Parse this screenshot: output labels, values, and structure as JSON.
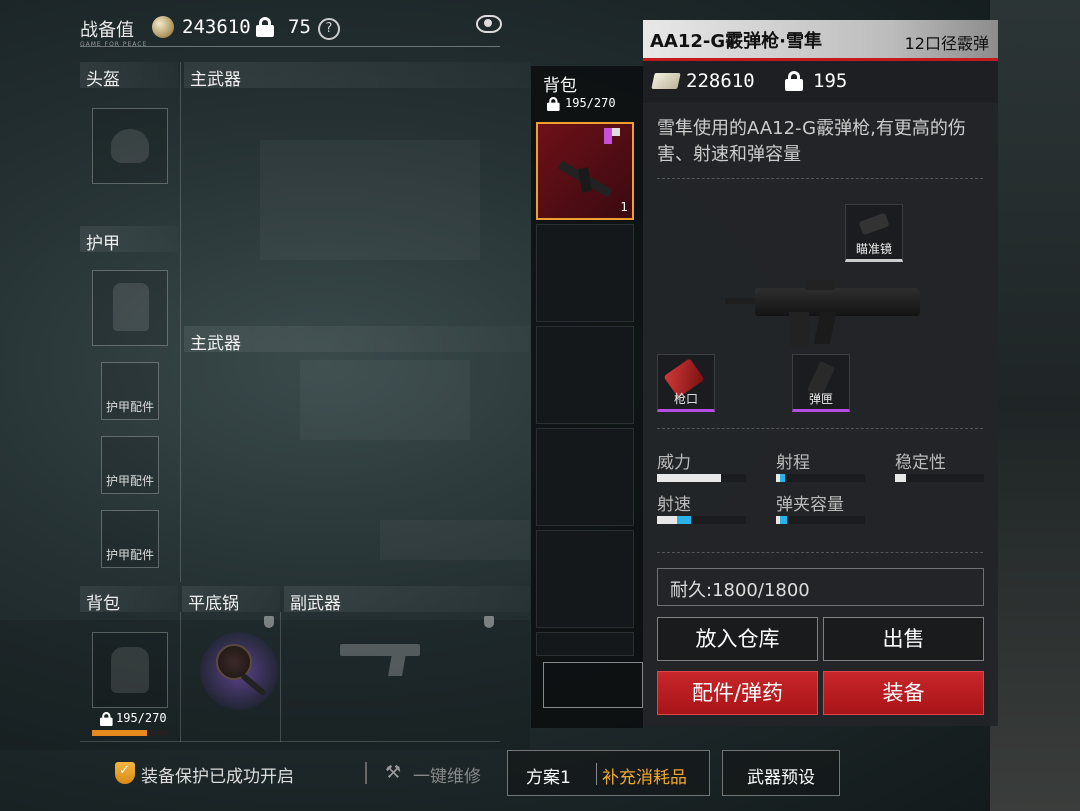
{
  "topbar": {
    "score_label": "战备值",
    "score_sub": "GAME FOR PEACE",
    "score_value": "243610",
    "lock_value": "75",
    "help_icon": "question-circle-icon",
    "eye_icon": "eye-icon"
  },
  "loadout": {
    "helmet_label": "头盔",
    "main_weapon_label_1": "主武器",
    "armor_label": "护甲",
    "main_weapon_label_2": "主武器",
    "armor_attachment_label": "护甲配件",
    "backpack_label": "背包",
    "pan_label": "平底锅",
    "secondary_weapon_label": "副武器",
    "backpack_capacity": "195/270",
    "backpack_fill_percent": 72
  },
  "bottom": {
    "protection_text": "装备保护已成功开启",
    "repair_text": "一键维修",
    "plan_label": "方案1",
    "supply_label": "补充消耗品",
    "preset_label": "武器预设"
  },
  "backpack_panel": {
    "title": "背包",
    "capacity": "195/270",
    "selected_item_count": "1"
  },
  "item_detail": {
    "name": "AA12-G霰弹枪·雪隼",
    "caliber": "12口径霰弹",
    "price": "228610",
    "lock_value": "195",
    "description": "雪隼使用的AA12-G霰弹枪,有更高的伤害、射速和弹容量",
    "attachments": {
      "scope": "瞄准镜",
      "muzzle": "枪口",
      "magazine": "弹匣"
    },
    "stats": [
      {
        "label": "威力",
        "value": 0.72,
        "bonus": 0
      },
      {
        "label": "射程",
        "value": 0.04,
        "bonus": 0.06
      },
      {
        "label": "稳定性",
        "value": 0.12,
        "bonus": 0
      },
      {
        "label": "射速",
        "value": 0.22,
        "bonus": 0.16
      },
      {
        "label": "弹夹容量",
        "value": 0.04,
        "bonus": 0.08
      }
    ],
    "durability": "耐久:1800/1800",
    "buttons": {
      "store": "放入仓库",
      "sell": "出售",
      "attachments_ammo": "配件/弹药",
      "equip": "装备"
    },
    "colors": {
      "accent_red": "#c41a1f",
      "stat_blue": "#27b4e8",
      "rarity_purple": "#c84fd8",
      "supply_orange": "#f0a830"
    }
  }
}
